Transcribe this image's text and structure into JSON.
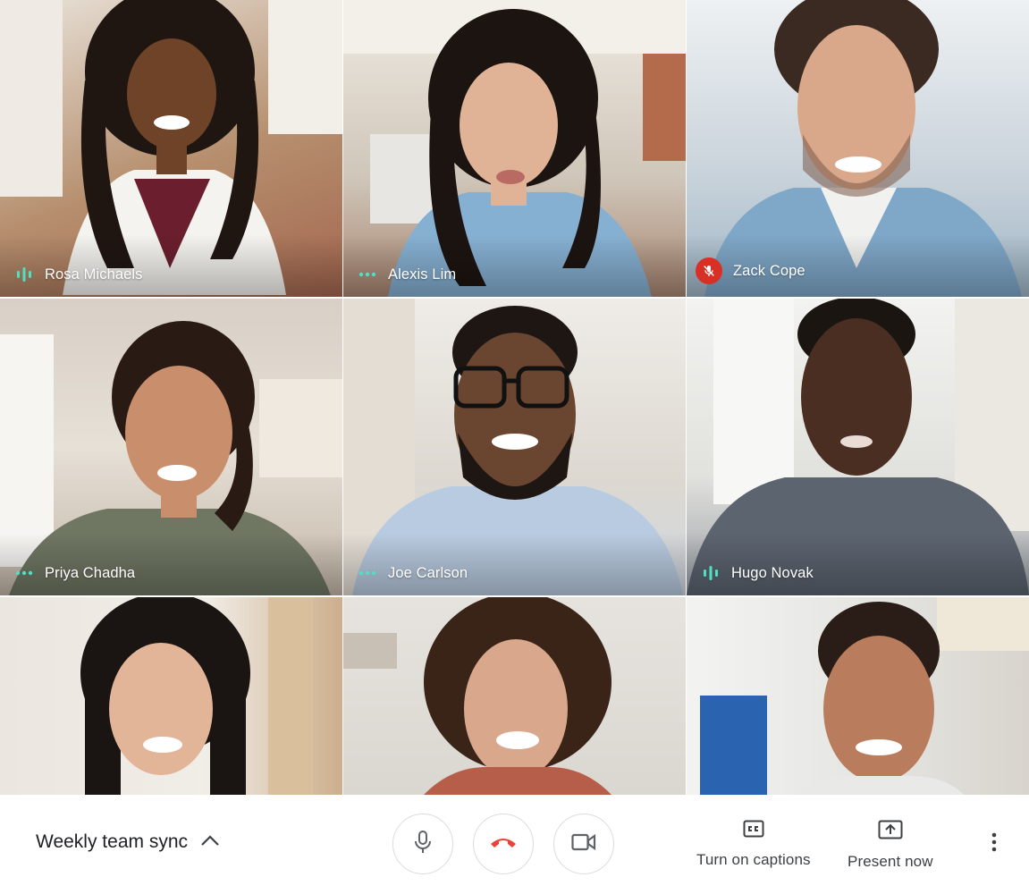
{
  "participants": [
    {
      "name": "Rosa Michaels",
      "indicator": "speaking",
      "bg": "#c9b8a6"
    },
    {
      "name": "Alexis Lim",
      "indicator": "ellipsis",
      "bg": "#c7bfb4"
    },
    {
      "name": "Zack Cope",
      "indicator": "muted",
      "bg": "#c9d1d8"
    },
    {
      "name": "Priya Chadha",
      "indicator": "ellipsis",
      "bg": "#d5cbc1"
    },
    {
      "name": "Joe Carlson",
      "indicator": "ellipsis",
      "bg": "#d9d6d0"
    },
    {
      "name": "Hugo Novak",
      "indicator": "speaking",
      "bg": "#d7d7d3"
    },
    {
      "name": "",
      "indicator": "",
      "bg": "#e4ddd3"
    },
    {
      "name": "",
      "indicator": "",
      "bg": "#dcdcd8"
    },
    {
      "name": "",
      "indicator": "",
      "bg": "#d6d7d6"
    }
  ],
  "bottom_bar": {
    "meeting_title": "Weekly team sync",
    "captions_label": "Turn on captions",
    "present_label": "Present now",
    "icons": {
      "details": "chevron-up-icon",
      "mic": "mic-icon",
      "hangup": "hangup-icon",
      "camera": "camera-icon",
      "captions": "captions-icon",
      "present": "present-icon",
      "more": "more-vert-icon"
    }
  },
  "colors": {
    "accent_teal": "#4fe0c4",
    "muted_red": "#d93025",
    "hangup_red": "#ea4335",
    "icon_gray": "#5f6368",
    "text_dark": "#202124"
  }
}
